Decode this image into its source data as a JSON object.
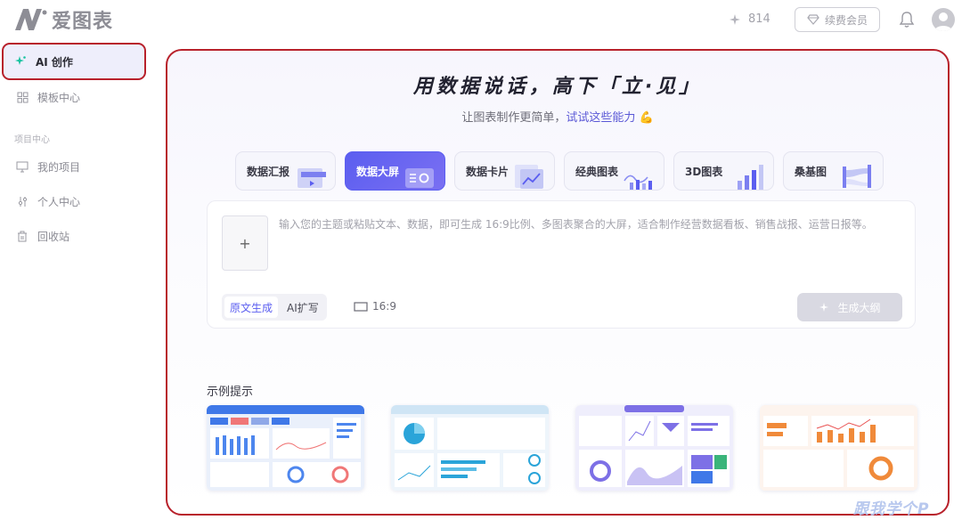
{
  "app": {
    "logo_text": "爱图表"
  },
  "header": {
    "points": "814",
    "vip_label": "续费会员"
  },
  "sidebar": {
    "items": [
      {
        "label": "AI 创作"
      },
      {
        "label": "模板中心"
      }
    ],
    "section_label": "项目中心",
    "project_items": [
      {
        "label": "我的项目"
      },
      {
        "label": "个人中心"
      },
      {
        "label": "回收站"
      }
    ]
  },
  "main": {
    "headline": "用数据说话，高下「立·见」",
    "subline_plain": "让图表制作更简单，",
    "subline_highlight": "试试这些能力",
    "subline_emoji": "💪",
    "tabs": [
      {
        "label": "数据汇报",
        "art": "doc-chart"
      },
      {
        "label": "数据大屏",
        "art": "screen"
      },
      {
        "label": "数据卡片",
        "art": "card-line"
      },
      {
        "label": "经典图表",
        "art": "classic-bars"
      },
      {
        "label": "3D图表",
        "art": "3d-bars"
      },
      {
        "label": "桑基图",
        "art": "sankey"
      }
    ],
    "active_tab": "数据大屏",
    "upload_symbol": "+",
    "prompt_placeholder": "输入您的主题或粘贴文本、数据，即可生成 16:9比例、多图表聚合的大屏，适合制作经营数据看板、销售战报、运营日报等。",
    "modes": [
      {
        "label": "原文生成"
      },
      {
        "label": "AI扩写"
      }
    ],
    "ratio_label": "16:9",
    "generate_label": "生成大纲",
    "examples_label": "示例提示"
  },
  "watermark": "跟我学个P",
  "colors": {
    "accent": "#5b5ef0",
    "highlight_border": "#b8212b"
  }
}
